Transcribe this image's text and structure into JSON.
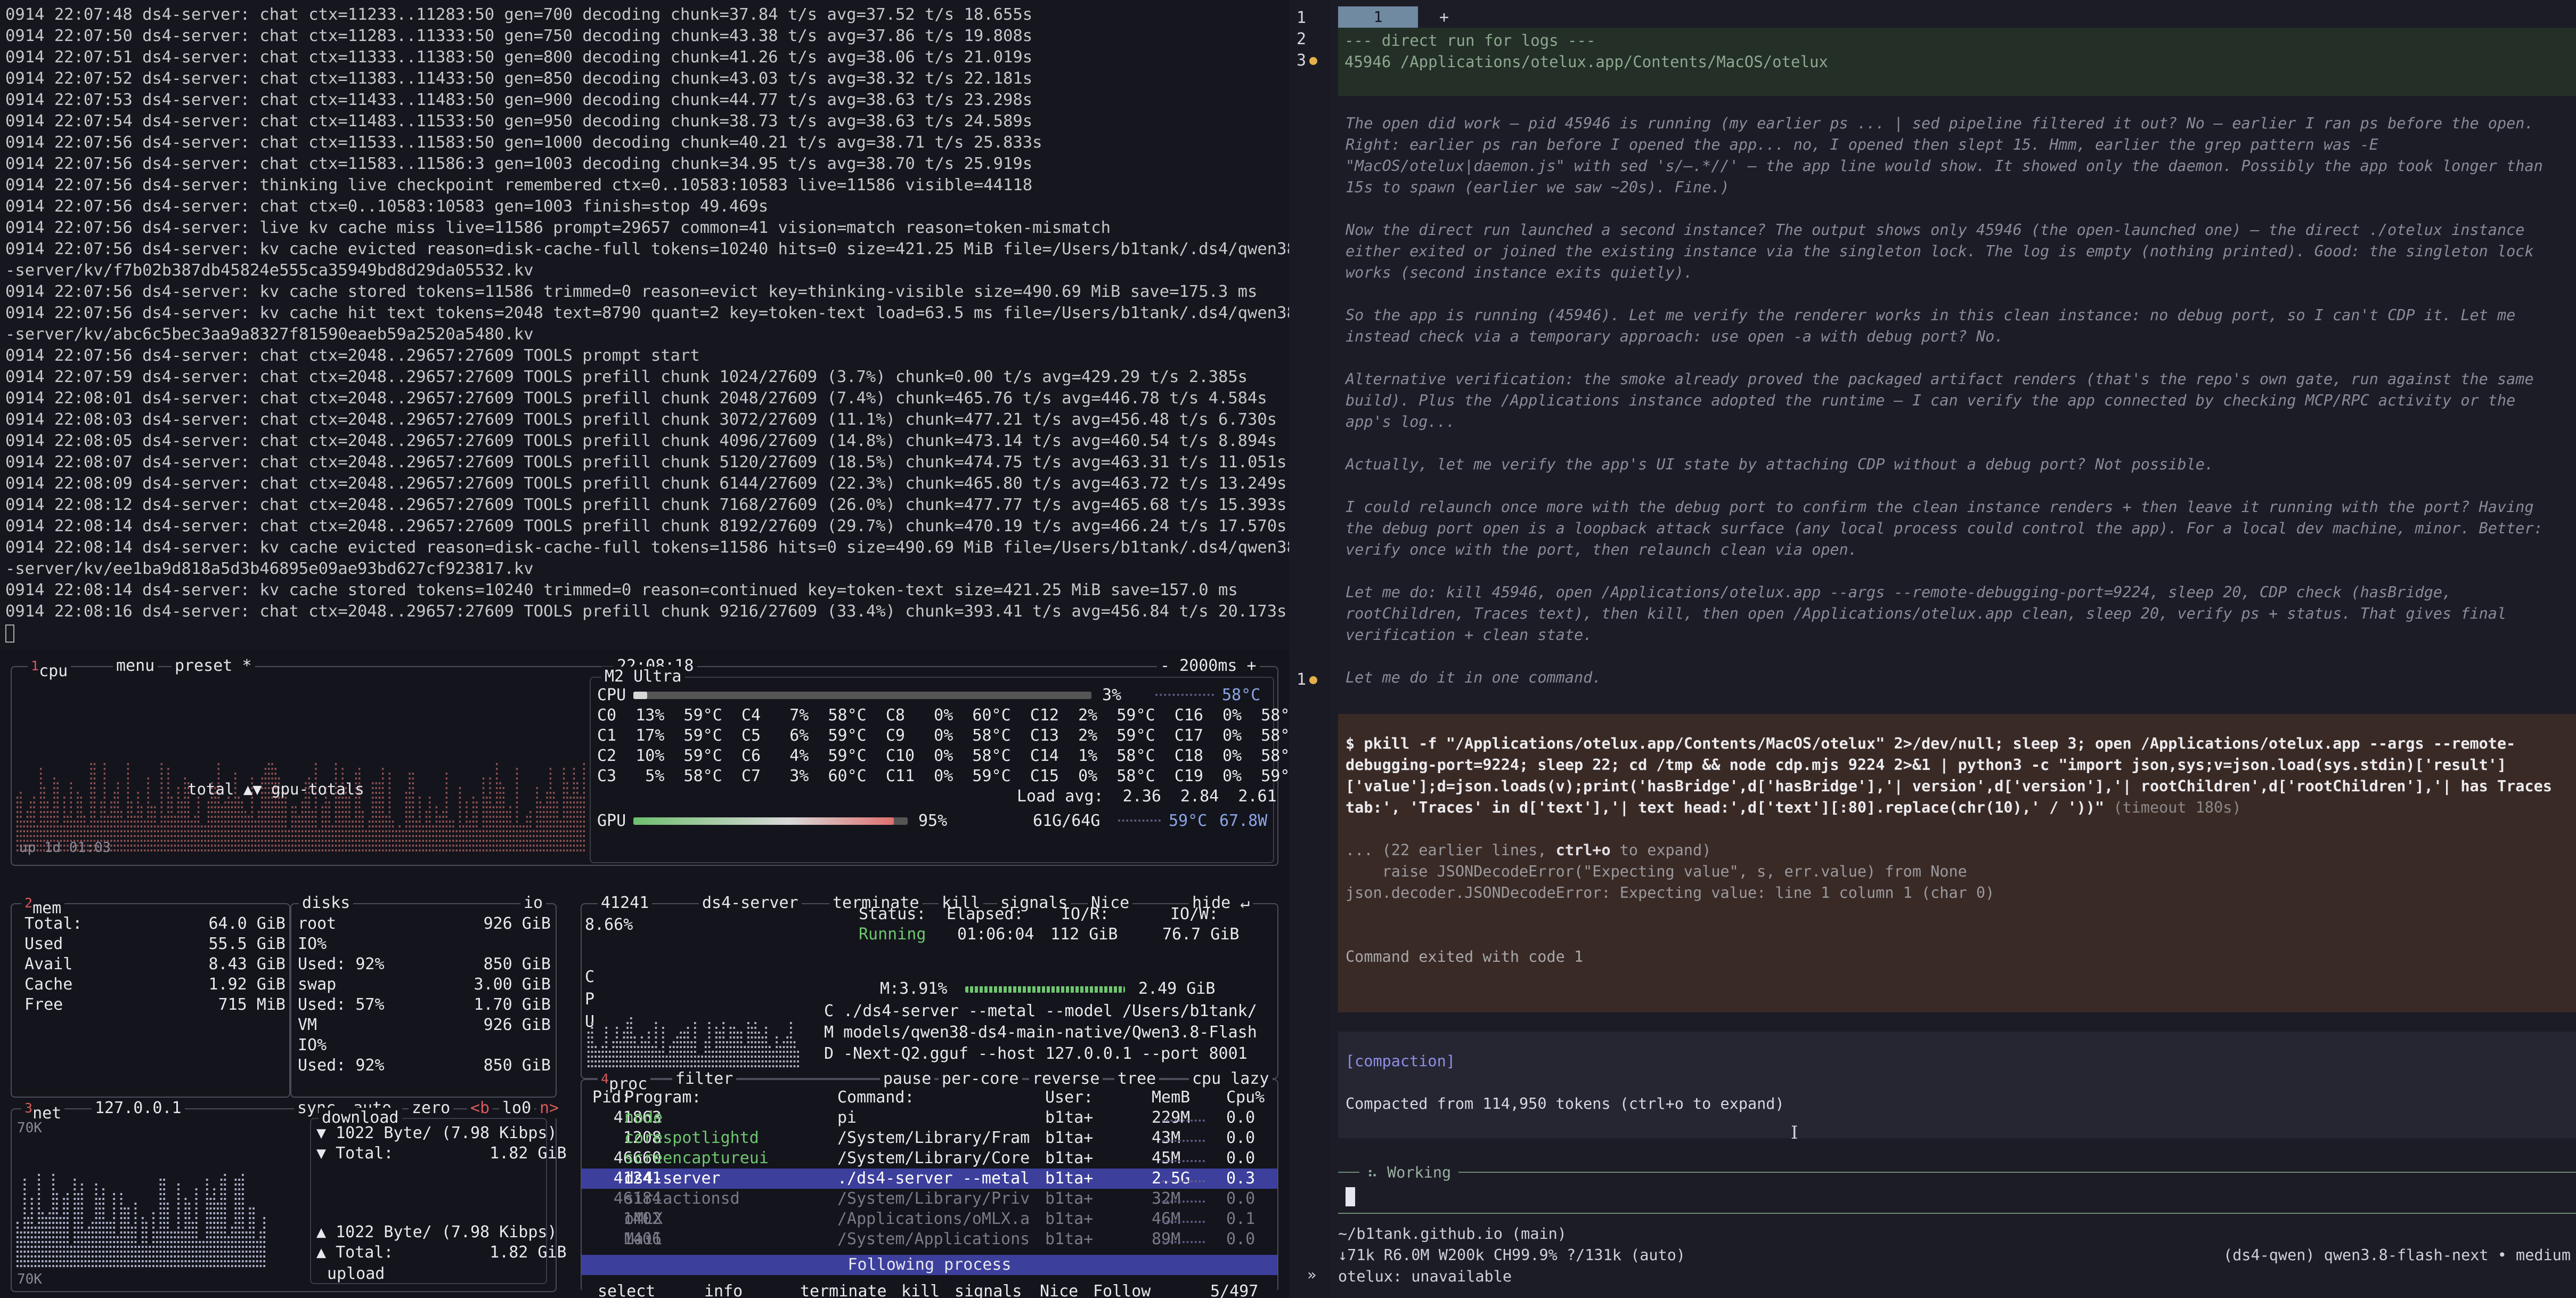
{
  "log": {
    "lines": [
      "0914 22:07:48 ds4-server: chat ctx=11233..11283:50 gen=700 decoding chunk=37.84 t/s avg=37.52 t/s 18.655s",
      "0914 22:07:50 ds4-server: chat ctx=11283..11333:50 gen=750 decoding chunk=43.38 t/s avg=37.86 t/s 19.808s",
      "0914 22:07:51 ds4-server: chat ctx=11333..11383:50 gen=800 decoding chunk=41.26 t/s avg=38.06 t/s 21.019s",
      "0914 22:07:52 ds4-server: chat ctx=11383..11433:50 gen=850 decoding chunk=43.03 t/s avg=38.32 t/s 22.181s",
      "0914 22:07:53 ds4-server: chat ctx=11433..11483:50 gen=900 decoding chunk=44.77 t/s avg=38.63 t/s 23.298s",
      "0914 22:07:54 ds4-server: chat ctx=11483..11533:50 gen=950 decoding chunk=38.73 t/s avg=38.63 t/s 24.589s",
      "0914 22:07:56 ds4-server: chat ctx=11533..11583:50 gen=1000 decoding chunk=40.21 t/s avg=38.71 t/s 25.833s",
      "0914 22:07:56 ds4-server: chat ctx=11583..11586:3 gen=1003 decoding chunk=34.95 t/s avg=38.70 t/s 25.919s",
      "0914 22:07:56 ds4-server: thinking live checkpoint remembered ctx=0..10583:10583 live=11586 visible=44118",
      "0914 22:07:56 ds4-server: chat ctx=0..10583:10583 gen=1003 finish=stop 49.469s",
      "0914 22:07:56 ds4-server: live kv cache miss live=11586 prompt=29657 common=41 vision=match reason=token-mismatch",
      "0914 22:07:56 ds4-server: kv cache evicted reason=disk-cache-full tokens=10240 hits=0 size=421.25 MiB file=/Users/b1tank/.ds4/qwen38",
      "-server/kv/f7b02b387db45824e555ca35949bd8d29da05532.kv",
      "0914 22:07:56 ds4-server: kv cache stored tokens=11586 trimmed=0 reason=evict key=thinking-visible size=490.69 MiB save=175.3 ms",
      "0914 22:07:56 ds4-server: kv cache hit text tokens=2048 text=8790 quant=2 key=token-text load=63.5 ms file=/Users/b1tank/.ds4/qwen38",
      "-server/kv/abc6c5bec3aa9a8327f81590eaeb59a2520a5480.kv",
      "0914 22:07:56 ds4-server: chat ctx=2048..29657:27609 TOOLS prompt start",
      "0914 22:07:59 ds4-server: chat ctx=2048..29657:27609 TOOLS prefill chunk 1024/27609 (3.7%) chunk=0.00 t/s avg=429.29 t/s 2.385s",
      "0914 22:08:01 ds4-server: chat ctx=2048..29657:27609 TOOLS prefill chunk 2048/27609 (7.4%) chunk=465.76 t/s avg=446.78 t/s 4.584s",
      "0914 22:08:03 ds4-server: chat ctx=2048..29657:27609 TOOLS prefill chunk 3072/27609 (11.1%) chunk=477.21 t/s avg=456.48 t/s 6.730s",
      "0914 22:08:05 ds4-server: chat ctx=2048..29657:27609 TOOLS prefill chunk 4096/27609 (14.8%) chunk=473.14 t/s avg=460.54 t/s 8.894s",
      "0914 22:08:07 ds4-server: chat ctx=2048..29657:27609 TOOLS prefill chunk 5120/27609 (18.5%) chunk=474.75 t/s avg=463.31 t/s 11.051s",
      "0914 22:08:09 ds4-server: chat ctx=2048..29657:27609 TOOLS prefill chunk 6144/27609 (22.3%) chunk=465.80 t/s avg=463.72 t/s 13.249s",
      "0914 22:08:12 ds4-server: chat ctx=2048..29657:27609 TOOLS prefill chunk 7168/27609 (26.0%) chunk=477.77 t/s avg=465.68 t/s 15.393s",
      "0914 22:08:14 ds4-server: chat ctx=2048..29657:27609 TOOLS prefill chunk 8192/27609 (29.7%) chunk=470.19 t/s avg=466.24 t/s 17.570s",
      "0914 22:08:14 ds4-server: kv cache evicted reason=disk-cache-full tokens=11586 hits=0 size=490.69 MiB file=/Users/b1tank/.ds4/qwen38",
      "-server/kv/ee1ba9d818a5d3b46895e09ae93bd627cf923817.kv",
      "0914 22:08:14 ds4-server: kv cache stored tokens=10240 trimmed=0 reason=continued key=token-text size=421.25 MiB save=157.0 ms",
      "0914 22:08:16 ds4-server: chat ctx=2048..29657:27609 TOOLS prefill chunk 9216/27609 (33.4%) chunk=393.41 t/s avg=456.84 t/s 20.173s"
    ]
  },
  "btop": {
    "cpu": {
      "title_num": "1",
      "title": "cpu",
      "menu": "menu",
      "preset": "preset *",
      "clock": "22:08:18",
      "interval": "- 2000ms +",
      "model": "M2 Ultra",
      "total_label": "CPU",
      "total_pct": "3%",
      "total_temp": "58°C",
      "graph_label": "total ▲▼ gpu-totals",
      "uptime": "up 1d 01:03",
      "cores": [
        "C0  13%  59°C  C4   7%  58°C  C8   0%  60°C  C12  2%  59°C  C16  0%  58°C",
        "C1  17%  59°C  C5   6%  59°C  C9   0%  58°C  C13  2%  59°C  C17  0%  58°C",
        "C2  10%  59°C  C6   4%  59°C  C10  0%  58°C  C14  1%  58°C  C18  0%  58°C",
        "C3   5%  58°C  C7   3%  60°C  C11  0%  59°C  C15  0%  58°C  C19  0%  59°C"
      ],
      "load_avg": "Load avg:  2.36  2.84  2.61",
      "gpu_label": "GPU",
      "gpu_pct": "95%",
      "gpu_mem": "61G/64G",
      "gpu_temp": "59°C",
      "gpu_power": "67.8W",
      "total_fill": 0.03,
      "gpu_fill": 0.95
    },
    "mem": {
      "title_num": "2",
      "title": "mem",
      "rows": [
        {
          "label": "Total:",
          "value": "64.0 GiB"
        },
        {
          "label": "Used",
          "value": "55.5 GiB"
        },
        {
          "label": "Avail",
          "value": "8.43 GiB"
        },
        {
          "label": "Cache",
          "value": "1.92 GiB"
        },
        {
          "label": "Free",
          "value": "715 MiB"
        }
      ]
    },
    "disks": {
      "title": "disks",
      "io": "io",
      "rows": [
        {
          "name": "root",
          "size": "926 GiB"
        },
        {
          "name": "IO%",
          "size": ""
        },
        {
          "name": "Used: 92%",
          "size": "850 GiB"
        },
        {
          "name": "swap",
          "size": "3.00 GiB"
        },
        {
          "name": "Used: 57%",
          "size": "1.70 GiB"
        },
        {
          "name": "VM",
          "size": "926 GiB"
        },
        {
          "name": "IO%",
          "size": ""
        },
        {
          "name": "Used: 92%",
          "size": "850 GiB"
        }
      ]
    },
    "net": {
      "title_num": "3",
      "title": "net",
      "iface": "127.0.0.1",
      "sync": "sync",
      "auto": "auto",
      "zero": "zero",
      "b_toggle": "<b",
      "lo": "lo0",
      "n_toggle": "n>",
      "scale_top": "70K",
      "scale_bottom": "70K",
      "download": "download",
      "dl_rate": "▼ 1022 Byte/ (7.98 Kibps)",
      "dl_total": "▼ Total:          1.82 GiB",
      "ul_rate": "▲ 1022 Byte/ (7.98 Kibps)",
      "ul_total": "▲ Total:          1.82 GiB",
      "upload": "upload"
    },
    "detail": {
      "pid": "41241",
      "name": "ds4-server",
      "pct": "8.66%",
      "terminate": "terminate",
      "kill": "kill",
      "signals": "signals",
      "nice": "Nice",
      "hide": "hide ↵",
      "status_label": "Status:",
      "status": "Running",
      "elapsed_label": "Elapsed:",
      "elapsed": "01:06:04",
      "ior_label": "IO/R:",
      "ior": "112 GiB",
      "iow_label": "IO/W:",
      "iow": "76.7 GiB",
      "mem_pct": "M:3.91%",
      "mem": "2.49 GiB",
      "cmd": [
        "C ./ds4-server --metal --model /Users/b1tank/",
        "M models/qwen38-ds4-main-native/Qwen3.8-Flash",
        "D -Next-Q2.gguf --host 127.0.0.1 --port 8001"
      ],
      "letters": [
        "C",
        "P",
        "U"
      ]
    },
    "proc": {
      "title_num": "4",
      "title": "proc",
      "filter": "filter",
      "pause": "pause",
      "per_core": "per-core",
      "reverse": "reverse",
      "tree": "tree",
      "sort": "cpu lazy",
      "headers": [
        "Pid:",
        "Program:",
        "Command:",
        "User:",
        "MemB",
        "Cpu%"
      ],
      "rows": [
        {
          "pid": "41863",
          "program": "node",
          "command": "pi",
          "user": "b1ta+",
          "mem": "229M",
          "cpu": "0.0"
        },
        {
          "pid": "1208",
          "program": "corespotlightd",
          "command": "/System/Library/Fram",
          "user": "b1ta+",
          "mem": "43M",
          "cpu": "0.0"
        },
        {
          "pid": "46660",
          "program": "screencaptureui",
          "command": "/System/Library/Core",
          "user": "b1ta+",
          "mem": "45M",
          "cpu": "0.0"
        },
        {
          "pid": "41241",
          "program": "ds4-server",
          "command": "./ds4-server --metal",
          "user": "b1ta+",
          "mem": "2.5G",
          "cpu": "0.3"
        },
        {
          "pid": "46184",
          "program": "siriactionsd",
          "command": "/System/Library/Priv",
          "user": "b1ta+",
          "mem": "32M",
          "cpu": "0.0"
        },
        {
          "pid": "1402",
          "program": "oMLX",
          "command": "/Applications/oMLX.a",
          "user": "b1ta+",
          "mem": "46M",
          "cpu": "0.1"
        },
        {
          "pid": "1406",
          "program": "Mail",
          "command": "/System/Applications",
          "user": "b1ta+",
          "mem": "89M",
          "cpu": "0.0"
        }
      ],
      "following": "Following process",
      "footer": {
        "select": "select",
        "info": "info",
        "terminate": "terminate",
        "kill": "kill",
        "signals": "signals",
        "nice": "Nice",
        "follow": "Follow",
        "count": "5/497"
      }
    }
  },
  "agent": {
    "gutter": [
      "1",
      "2",
      "3",
      "1"
    ],
    "tab_label": "1",
    "tab_add": "+",
    "header_lines": [
      "--- direct run for logs ---",
      "45946 /Applications/otelux.app/Contents/MacOS/otelux"
    ],
    "thinking": [
      "The open did work — pid 45946 is running (my earlier ps ... | sed pipeline filtered it out? No — earlier I ran ps before the open. Right: earlier ps ran before I opened the app... no, I opened then slept 15. Hmm, earlier the grep pattern was -E \"MacOS/otelux|daemon.js\" with sed 's/—.*//' — the app line would show. It showed only the daemon. Possibly the app took longer than 15s to spawn (earlier we saw ~20s). Fine.)",
      "Now the direct run launched a second instance? The output shows only 45946 (the open-launched one) — the direct ./otelux instance either exited or joined the existing instance via the singleton lock. The log is empty (nothing printed). Good: the singleton lock works (second instance exits quietly).",
      "So the app is running (45946). Let me verify the renderer works in this clean instance: no debug port, so I can't CDP it. Let me instead check via a temporary approach: use open -a with debug port? No.",
      "Alternative verification: the smoke already proved the packaged artifact renders (that's the repo's own gate, run against the same build). Plus the /Applications instance adopted the runtime — I can verify the app connected by checking MCP/RPC activity or the app's log...",
      "Actually, let me verify the app's UI state by attaching CDP without a debug port? Not possible.",
      "I could relaunch once more with the debug port to confirm the clean instance renders + then leave it running with the port? Having the debug port open is a loopback attack surface (any local process could control the app). For a local dev machine, minor. Better: verify once with the port, then relaunch clean via open.",
      "Let me do: kill 45946, open /Applications/otelux.app --args --remote-debugging-port=9224, sleep 20, CDP check (hasBridge, rootChildren, Traces text), then kill, then open /Applications/otelux.app clean, sleep 20, verify ps + status. That gives final verification + clean state.",
      "Let me do it in one command."
    ],
    "command": "$ pkill -f \"/Applications/otelux.app/Contents/MacOS/otelux\" 2>/dev/null; sleep 3; open /Applications/otelux.app --args --remote-debugging-port=9224; sleep 22; cd /tmp && node cdp.mjs 9224 2>&1 | python3 -c \"import json,sys;v=json.load(sys.stdin)['result']['value'];d=json.loads(v);print('hasBridge',d['hasBridge'],'| version',d['version'],'| rootChildren',d['rootChildren'],'| has Traces tab:', 'Traces' in d['text'],'| text head:',d['text'][:80].replace(chr(10),' / '))\"",
    "command_timeout": "(timeout 180s)",
    "output": {
      "expand_prefix": "... (22 earlier lines, ",
      "expand_key": "ctrl+o",
      "expand_suffix": " to expand)",
      "line1": "    raise JSONDecodeError(\"Expecting value\", s, err.value) from None",
      "line2": "json.decoder.JSONDecodeError: Expecting value: line 1 column 1 (char 0)"
    },
    "exit": "Command exited with code 1",
    "compaction_title": "[compaction]",
    "compaction_msg": "Compacted from 114,950 tokens (ctrl+o to expand)",
    "working": "⠦ Working",
    "status_path": "~/b1tank.github.io (main)",
    "status_stats": "↓71k R6.0M W200k CH99.9% ?/131k (auto)",
    "status_model": "(ds4-qwen) qwen3.8-flash-next • medium",
    "status_prompt": "»",
    "status_ext": "otelux: unavailable"
  }
}
